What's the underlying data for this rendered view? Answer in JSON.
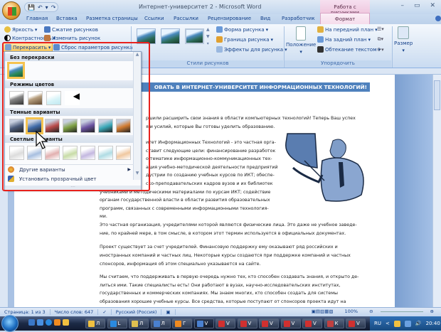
{
  "window": {
    "title": "Интернет-университет 2 - Microsoft Word",
    "context_group": "Работа с рисунками",
    "qat": [
      "💾",
      "↶",
      "▾",
      "↷",
      "▾"
    ],
    "controls": [
      "–",
      "▭",
      "✕"
    ]
  },
  "tabs": [
    "Главная",
    "Вставка",
    "Разметка страницы",
    "Ссылки",
    "Рассылки",
    "Рецензирование",
    "Вид",
    "Разработчик",
    "Формат"
  ],
  "ribbon": {
    "adjust": {
      "brightness": "Яркость",
      "contrast": "Контрастность",
      "recolor": "Перекрасить",
      "compress": "Сжатие рисунков",
      "change": "Изменить рисунок",
      "reset": "Сброс параметров рисунка"
    },
    "styles": {
      "label": "Стили рисунков",
      "shape": "Форма рисунка",
      "border": "Граница рисунка",
      "effects": "Эффекты для рисунка"
    },
    "arrange": {
      "label": "Упорядочить",
      "position": "Положение",
      "front": "На передний план",
      "back": "На задний план",
      "wrap": "Обтекание текстом"
    },
    "size": {
      "label": "Размер"
    }
  },
  "recolor_menu": {
    "no_recolor": "Без перекраски",
    "color_modes": "Режимы цветов",
    "dark": "Темные варианты",
    "light": "Светлые варианты",
    "more": "Другие варианты",
    "transparent": "Установить прозрачный цвет",
    "dark_colors": [
      "#4a5a7a",
      "#3f6aa8",
      "#b84a4a",
      "#7ea044",
      "#6a52a0",
      "#3aa8b8",
      "#d07a30"
    ],
    "light_colors": [
      "#dcdcdc",
      "#a8bfe0",
      "#e2b0b0",
      "#c8dca8",
      "#c4b8e0",
      "#b0dce4",
      "#f0c8a0"
    ]
  },
  "document": {
    "heading": "ОВАТЬ В ИНТЕРНЕТ-УНИВЕРСИТЕТ ИНФОРМАЦИОННЫХ ТЕХНОЛОГИЙ!",
    "p1": [
      "ршили расширить свои знания в области компьютерных технологий! Теперь Ваш успех",
      "я и усилий, которые Вы готовы уделить образованию."
    ],
    "p2": [
      "итет Информационных Технологий - это частная орга-",
      "ставит следующие цели:  финансирование разработок",
      "о тематике информационно-коммуникационных тех-",
      "ация учебно-методической деятельности предприятий",
      "дустрии по созданию учебных курсов по ИКТ; обеспе-",
      "ско-преподавательских кадров вузов и их библиотек",
      "учебниками и методическими материалами по курсам ИКТ; содействие",
      "органам государственной власти в области развития образовательных",
      "программ, связанных с современными информационными технология-",
      "ми."
    ],
    "p3": [
      "Это частная организация, учредителями которой являются физические лица. Это даже не учебное заведе-",
      "ние, по крайней мере, в том смысле, в котором этот термин используется в официальных документах."
    ],
    "p4": [
      "Проект существует за счет учредителей. Финансовую поддержку ему оказывают ряд российских и",
      "иностранных компаний и частных лиц. Некоторые курсы создаются при поддержке компаний и частных",
      "спонсоров, информация об этом специально указывается на сайте."
    ],
    "p5": [
      "Мы считаем, что поддерживать в первую очередь нужно тех, кто способен создавать знания, и открыто де-",
      "литься ими. Такие специалисты есть! Они работают в вузах, научно-исследовательских институтах,",
      "государственных и коммерческих компаниях. Мы знаем многих, кто способен создать для системы",
      "образования хорошие учебные курсы. Все средства, которые поступают от спонсоров проекта идут на"
    ]
  },
  "status": {
    "page": "Страница: 1 из 3",
    "words": "Число слов: 647",
    "lang": "Русский (Россия)",
    "zoom": "100%"
  },
  "taskbar": {
    "items": [
      "Л",
      "L",
      "Л",
      "Л",
      "Г",
      "V",
      "V",
      "V",
      "V",
      "V",
      "V",
      "К",
      "V"
    ],
    "lang": "RU",
    "time": "20:40"
  }
}
